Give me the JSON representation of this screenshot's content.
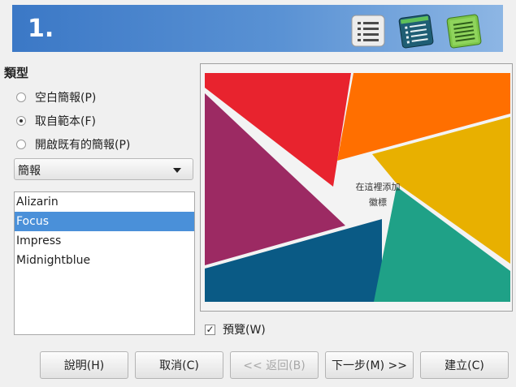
{
  "header": {
    "step_number": "1.",
    "icons": [
      "list-icon",
      "outline-icon",
      "notes-icon"
    ]
  },
  "type_section": {
    "label": "類型",
    "options": [
      {
        "label": "空白簡報(P)",
        "checked": false
      },
      {
        "label": "取自範本(F)",
        "checked": true
      },
      {
        "label": "開啟既有的簡報(P)",
        "checked": false
      }
    ]
  },
  "category_dropdown": {
    "selected": "簡報"
  },
  "templates": {
    "items": [
      "Alizarin",
      "Focus",
      "Impress",
      "Midnightblue"
    ],
    "selected_index": 1
  },
  "preview": {
    "logo_text_line1": "在這裡添加",
    "logo_text_line2": "徽標",
    "colors": {
      "red": "#e8232e",
      "orange": "#ff6f00",
      "purple": "#9c2a63",
      "yellow": "#e8b000",
      "blue": "#0a5a85",
      "teal": "#1fa187"
    }
  },
  "preview_checkbox": {
    "label": "預覽(W)",
    "checked": true
  },
  "buttons": {
    "help": "說明(H)",
    "cancel": "取消(C)",
    "back": "<< 返回(B)",
    "next": "下一步(M) >>",
    "create": "建立(C)"
  }
}
